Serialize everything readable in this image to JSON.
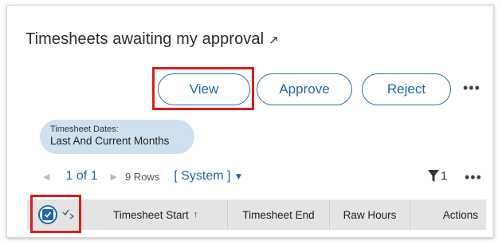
{
  "widget": {
    "title": "Timesheets awaiting my approval",
    "title_link_icon": "external-arrow-icon"
  },
  "toolbar": {
    "view_label": "View",
    "approve_label": "Approve",
    "reject_label": "Reject",
    "more_icon": "more-horizontal-icon"
  },
  "filter_chip": {
    "label": "Timesheet Dates:",
    "value": "Last And Current Months"
  },
  "pager": {
    "page_text": "1 of 1",
    "rows_text": "9 Rows",
    "view_selector": "[ System ]",
    "filter_count": "1"
  },
  "table": {
    "columns": [
      "Timesheet Start",
      "Timesheet End",
      "Raw Hours",
      "Actions"
    ],
    "sort_column": "Timesheet Start",
    "sort_direction": "ascending"
  },
  "colors": {
    "accent": "#1f67a9",
    "highlight": "#e01b1b",
    "chip_bg": "#cfe1ee",
    "header_bg": "#e4e4e4"
  }
}
